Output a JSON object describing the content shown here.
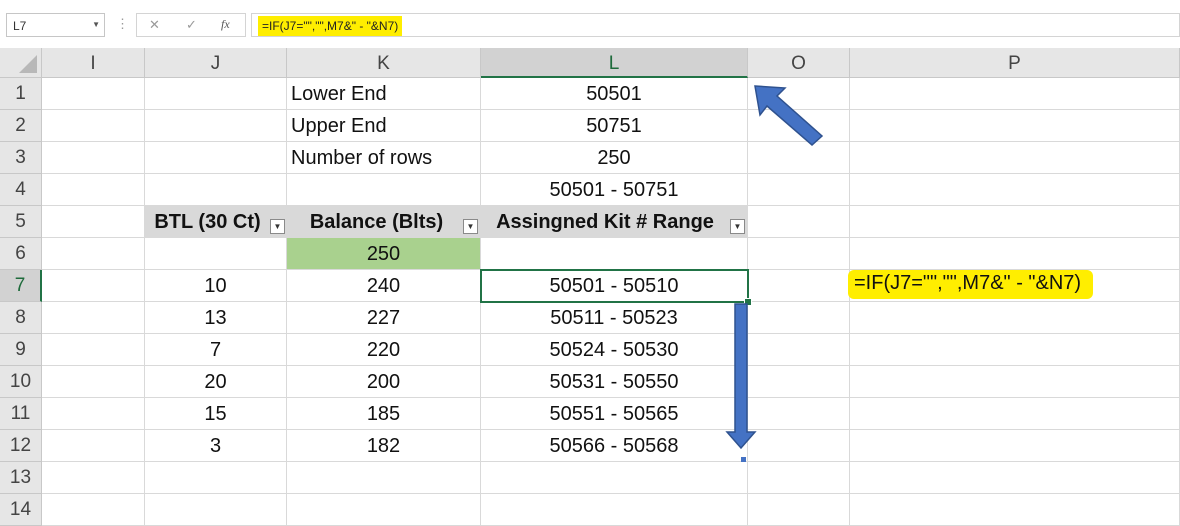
{
  "formula_bar": {
    "name_box": "L7",
    "cancel_icon": "x-icon",
    "enter_icon": "check-icon",
    "function_label": "fx",
    "formula": "=IF(J7=\"\",\"\",M7&\" - \"&N7)"
  },
  "columns": [
    "I",
    "J",
    "K",
    "L",
    "O",
    "P"
  ],
  "selected_column": "L",
  "rows": [
    "1",
    "2",
    "3",
    "4",
    "5",
    "6",
    "7",
    "8",
    "9",
    "10",
    "11",
    "12",
    "13",
    "14"
  ],
  "selected_row": "7",
  "cells": {
    "K1": "Lower End",
    "L1": "50501",
    "K2": "Upper End",
    "L2": "50751",
    "K3": "Number of rows",
    "L3": "250",
    "L4": "50501 - 50751",
    "J5": "BTL (30 Ct)",
    "K5": "Balance (Blts)",
    "L5": "Assingned Kit # Range",
    "K6": "250",
    "J7": "10",
    "K7": "240",
    "L7": "50501 - 50510",
    "J8": "13",
    "K8": "227",
    "L8": "50511 - 50523",
    "J9": "7",
    "K9": "220",
    "L9": "50524 - 50530",
    "J10": "20",
    "K10": "200",
    "L10": "50531 - 50550",
    "J11": "15",
    "K11": "185",
    "L11": "50551 - 50565",
    "J12": "3",
    "K12": "182",
    "L12": "50566 - 50568"
  },
  "annotation_text": "=IF(J7=\"\",\"\",M7&\" - \"&N7)",
  "colors": {
    "highlight": "#ffee00",
    "balance_fill": "#a9d18e",
    "header_fill": "#d9d9d9",
    "selection": "#217346",
    "arrow_fill": "#4472c4",
    "arrow_stroke": "#2f528f"
  }
}
